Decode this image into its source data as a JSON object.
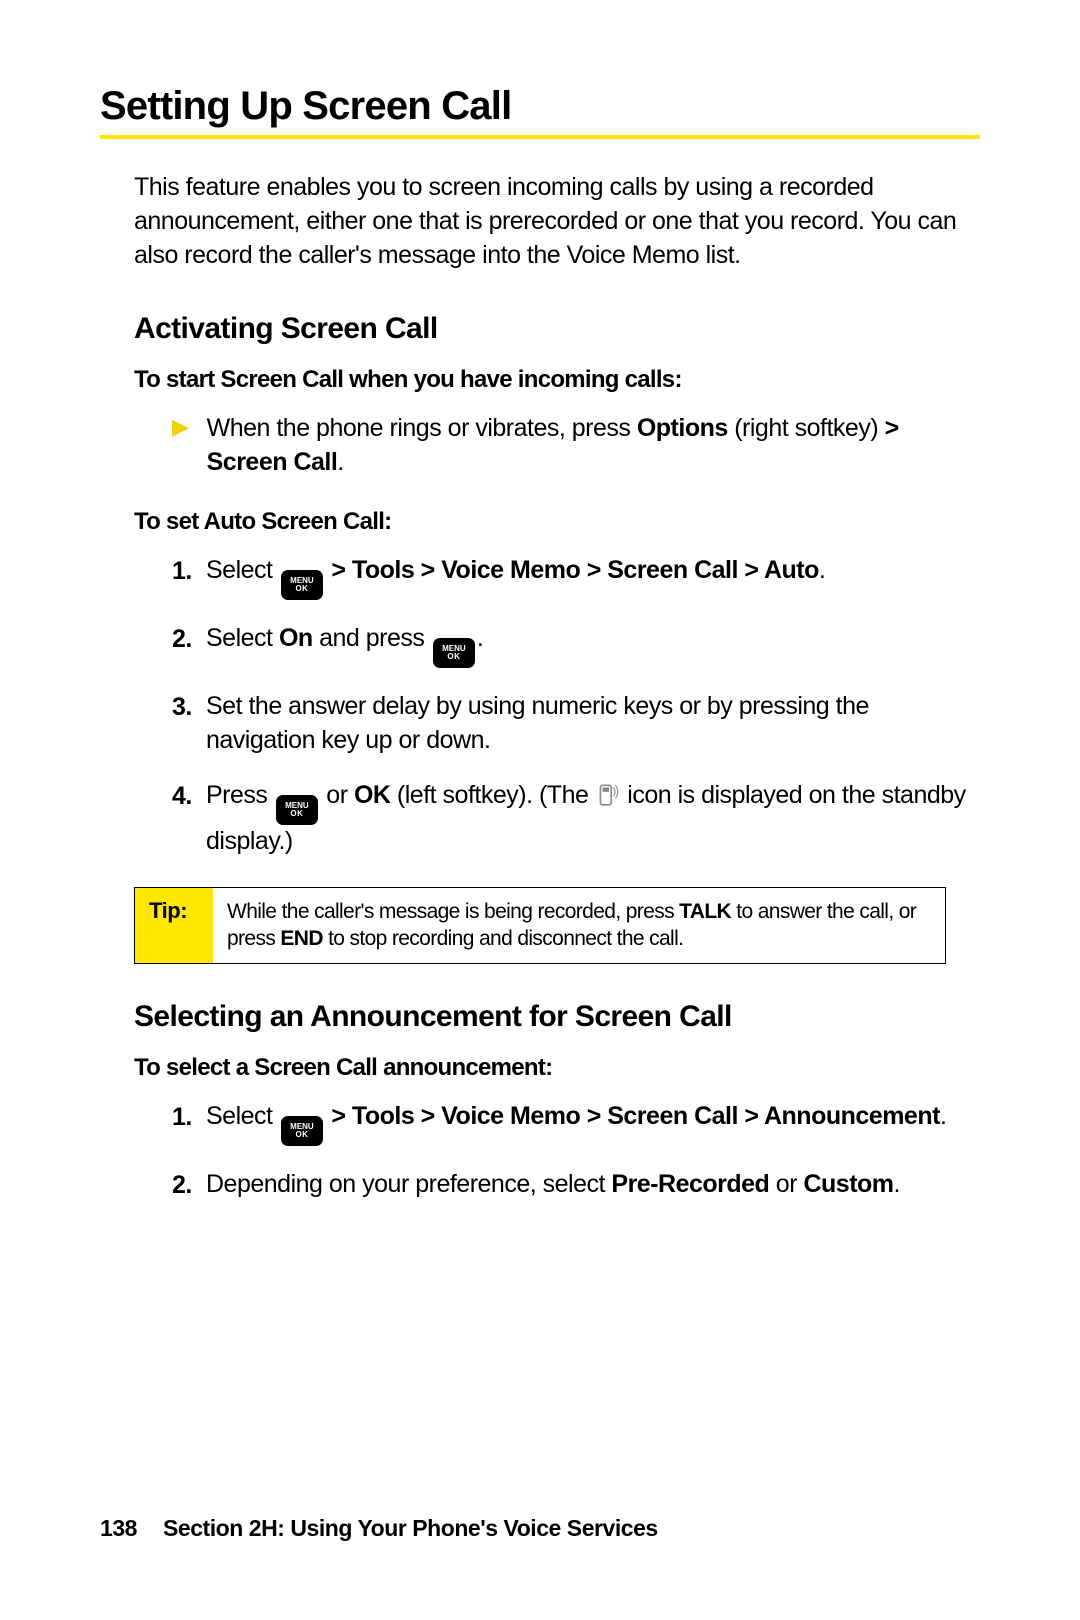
{
  "title": "Setting Up Screen Call",
  "intro": "This feature enables you to screen incoming calls by using a recorded announcement, either one that is prerecorded or one that you record. You can also record the caller's message into the Voice Memo list.",
  "section1": {
    "heading": "Activating Screen Call",
    "sub1": "To start Screen Call when you have incoming calls:",
    "bullet": {
      "pre": "When the phone rings or vibrates, press ",
      "b1": "Options",
      "mid": " (right softkey) ",
      "b2": "> Screen Call",
      "post": "."
    },
    "sub2": "To set Auto Screen Call:",
    "steps": {
      "s1": {
        "pre": "Select ",
        "b1": " > Tools > Voice Memo > Screen Call > Auto",
        "post": "."
      },
      "s2": {
        "pre": "Select ",
        "b1": "On",
        "mid": " and press ",
        "post": "."
      },
      "s3": "Set the answer delay by using numeric keys or by pressing the navigation key up or down.",
      "s4": {
        "pre": "Press ",
        "mid1": " or ",
        "b1": "OK",
        "mid2": " (left softkey). (The ",
        "post": " icon is displayed on the standby display.)"
      }
    }
  },
  "tip": {
    "label": "Tip:",
    "pre": "While the caller's message is being recorded, press ",
    "b1": "TALK",
    "mid": " to answer the call, or press ",
    "b2": "END",
    "post": " to stop recording and disconnect the call."
  },
  "section2": {
    "heading": "Selecting an Announcement for Screen Call",
    "sub1": "To select a Screen Call announcement:",
    "steps": {
      "s1": {
        "pre": "Select ",
        "b1": " > Tools > Voice Memo > Screen Call > Announcement",
        "post": "."
      },
      "s2": {
        "pre": "Depending on your preference, select ",
        "b1": "Pre-Recorded",
        "mid": " or ",
        "b2": "Custom",
        "post": "."
      }
    }
  },
  "footer": {
    "page": "138",
    "text": "Section 2H: Using Your Phone's Voice Services"
  },
  "menu_key": {
    "l1": "MENU",
    "l2": "OK"
  }
}
